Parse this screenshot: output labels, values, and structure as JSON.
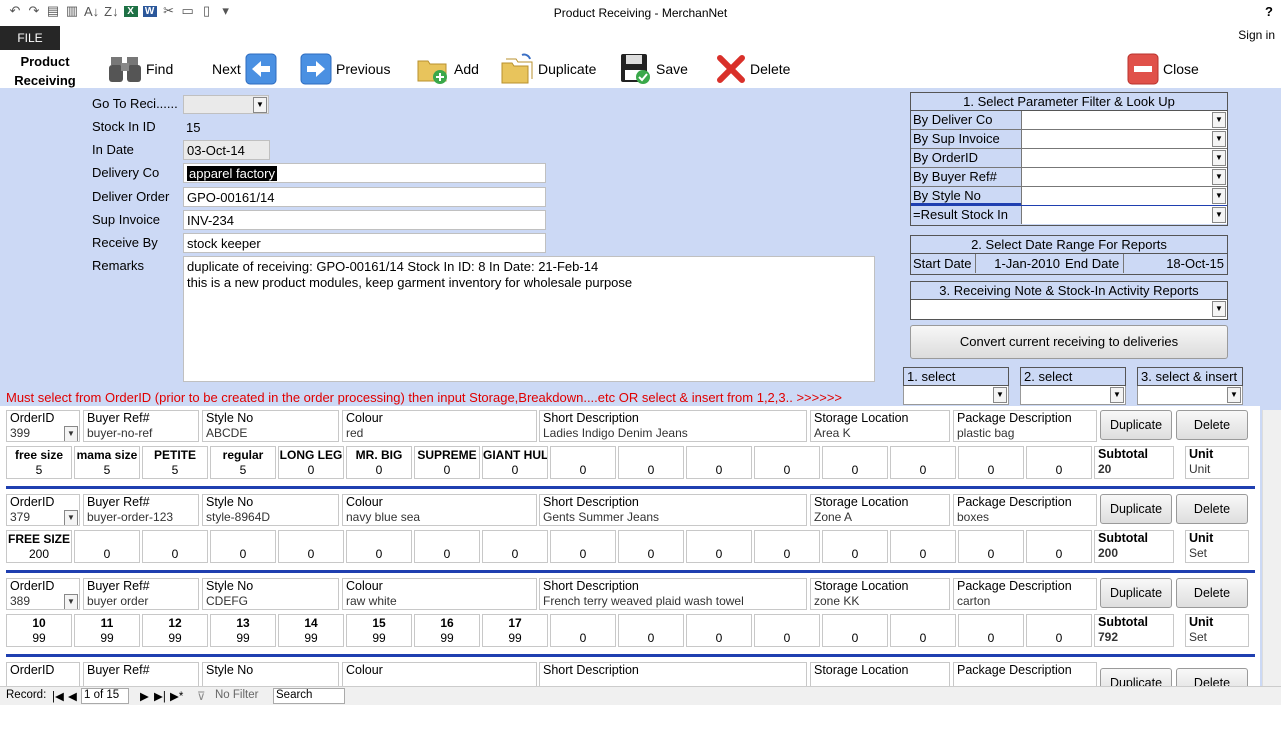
{
  "window": {
    "title": "Product Receiving - MerchanNet",
    "help": "?",
    "file_tab": "FILE",
    "sign_in": "Sign in"
  },
  "qat": [
    "↶",
    "↷",
    "▤",
    "▥",
    "A↓",
    "Z↓",
    "X",
    "W",
    "✂",
    "▭",
    "▯",
    "▾"
  ],
  "toolbar": {
    "form_title": "Product Receiving",
    "find": "Find",
    "next": "Next",
    "previous": "Previous",
    "add": "Add",
    "duplicate": "Duplicate",
    "save": "Save",
    "delete": "Delete",
    "close": "Close"
  },
  "form": {
    "goto_label": "Go To Reci......",
    "goto_value": "",
    "stock_in_id_label": "Stock In ID",
    "stock_in_id": "15",
    "in_date_label": "In Date",
    "in_date": "03-Oct-14",
    "delivery_co_label": "Delivery Co",
    "delivery_co": "apparel factory",
    "deliver_order_label": "Deliver Order",
    "deliver_order": "GPO-00161/14",
    "sup_invoice_label": "Sup Invoice",
    "sup_invoice": "INV-234",
    "receive_by_label": "Receive By",
    "receive_by": "stock keeper",
    "remarks_label": "Remarks",
    "remarks_line1": "duplicate of receiving: GPO-00161/14 Stock In ID: 8  In Date: 21-Feb-14",
    "remarks_line2": "this is a new product modules, keep garment inventory for wholesale purpose"
  },
  "filter": {
    "header": "1. Select Parameter Filter & Look Up",
    "by_deliver_co": "By Deliver Co",
    "by_sup_invoice": "By Sup Invoice",
    "by_order_id": "By OrderID",
    "by_buyer_ref": "By Buyer Ref#",
    "by_style_no": "By Style No",
    "result_stock_in": "=Result Stock In"
  },
  "date_range": {
    "header": "2. Select Date Range For  Reports",
    "start_label": "Start Date",
    "start": "1-Jan-2010",
    "end_label": "End Date",
    "end": "18-Oct-15"
  },
  "reports": {
    "header": "3. Receiving Note & Stock-In Activity Reports",
    "value": ""
  },
  "convert_button": "Convert current receiving to deliveries",
  "warning": "Must select from OrderID (prior to be created in the order processing) then input Storage,Breakdown....etc OR select & insert from 1,2,3.. >>>>>>",
  "selects": [
    "1. select",
    "2. select",
    "3. select & insert"
  ],
  "col_headers": {
    "order_id": "OrderID",
    "buyer_ref": "Buyer Ref#",
    "style_no": "Style No",
    "colour": "Colour",
    "short_desc": "Short Description",
    "storage": "Storage Location",
    "package": "Package Description",
    "subtotal": "Subtotal",
    "unit": "Unit",
    "dup_btn": "Duplicate",
    "del_btn": "Delete"
  },
  "rows": [
    {
      "order_id": "399",
      "buyer_ref": "buyer-no-ref",
      "style_no": "ABCDE",
      "colour": "red",
      "short_desc": "Ladies Indigo Denim Jeans",
      "storage": "Area K",
      "package": "plastic bag",
      "subtotal": "20",
      "unit": "Unit",
      "sizes": [
        {
          "h": "free size",
          "v": "5"
        },
        {
          "h": "mama size",
          "v": "5"
        },
        {
          "h": "PETITE",
          "v": "5"
        },
        {
          "h": "regular",
          "v": "5"
        },
        {
          "h": "LONG LEG",
          "v": "0"
        },
        {
          "h": "MR. BIG",
          "v": "0"
        },
        {
          "h": "SUPREME",
          "v": "0"
        },
        {
          "h": "GIANT HULK",
          "v": "0"
        },
        {
          "h": "",
          "v": "0"
        },
        {
          "h": "",
          "v": "0"
        },
        {
          "h": "",
          "v": "0"
        },
        {
          "h": "",
          "v": "0"
        },
        {
          "h": "",
          "v": "0"
        },
        {
          "h": "",
          "v": "0"
        },
        {
          "h": "",
          "v": "0"
        },
        {
          "h": "",
          "v": "0"
        }
      ]
    },
    {
      "order_id": "379",
      "buyer_ref": "buyer-order-123",
      "style_no": "style-8964D",
      "colour": "navy blue sea",
      "short_desc": "Gents Summer Jeans",
      "storage": "Zone A",
      "package": "boxes",
      "subtotal": "200",
      "unit": "Set",
      "sizes": [
        {
          "h": "FREE SIZE",
          "v": "200"
        },
        {
          "h": "",
          "v": "0"
        },
        {
          "h": "",
          "v": "0"
        },
        {
          "h": "",
          "v": "0"
        },
        {
          "h": "",
          "v": "0"
        },
        {
          "h": "",
          "v": "0"
        },
        {
          "h": "",
          "v": "0"
        },
        {
          "h": "",
          "v": "0"
        },
        {
          "h": "",
          "v": "0"
        },
        {
          "h": "",
          "v": "0"
        },
        {
          "h": "",
          "v": "0"
        },
        {
          "h": "",
          "v": "0"
        },
        {
          "h": "",
          "v": "0"
        },
        {
          "h": "",
          "v": "0"
        },
        {
          "h": "",
          "v": "0"
        },
        {
          "h": "",
          "v": "0"
        }
      ]
    },
    {
      "order_id": "389",
      "buyer_ref": "buyer order",
      "style_no": "CDEFG",
      "colour": "raw white",
      "short_desc": "French terry weaved plaid wash towel",
      "storage": "zone KK",
      "package": "carton",
      "subtotal": "792",
      "unit": "Set",
      "sizes": [
        {
          "h": "10",
          "v": "99"
        },
        {
          "h": "11",
          "v": "99"
        },
        {
          "h": "12",
          "v": "99"
        },
        {
          "h": "13",
          "v": "99"
        },
        {
          "h": "14",
          "v": "99"
        },
        {
          "h": "15",
          "v": "99"
        },
        {
          "h": "16",
          "v": "99"
        },
        {
          "h": "17",
          "v": "99"
        },
        {
          "h": "",
          "v": "0"
        },
        {
          "h": "",
          "v": "0"
        },
        {
          "h": "",
          "v": "0"
        },
        {
          "h": "",
          "v": "0"
        },
        {
          "h": "",
          "v": "0"
        },
        {
          "h": "",
          "v": "0"
        },
        {
          "h": "",
          "v": "0"
        },
        {
          "h": "",
          "v": "0"
        }
      ]
    }
  ],
  "status": {
    "record_label": "Record:",
    "record_value": "1 of 15",
    "no_filter": "No Filter",
    "search": "Search"
  }
}
